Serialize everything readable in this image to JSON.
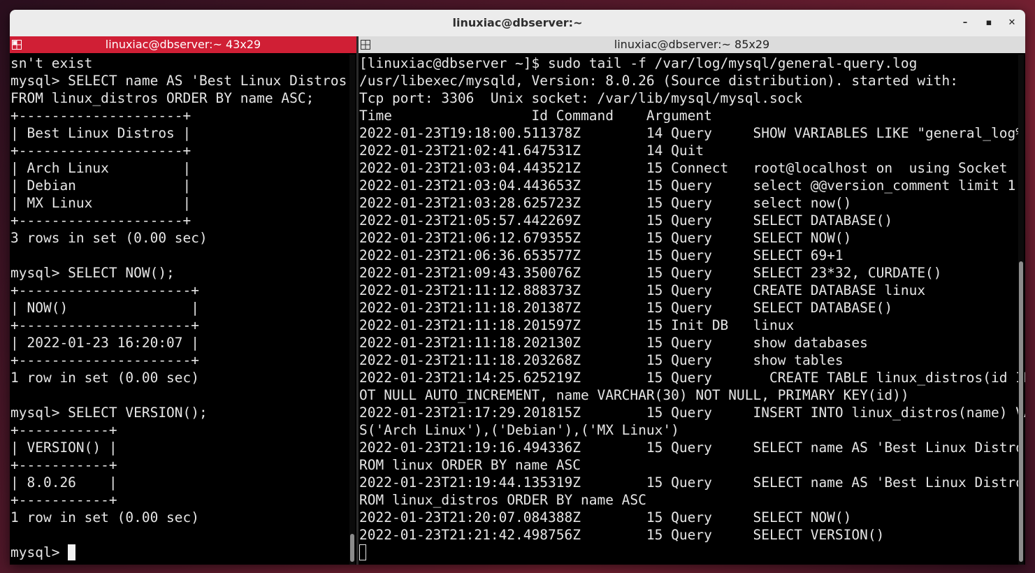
{
  "window": {
    "title": "linuxiac@dbserver:~",
    "minimize_glyph": "–",
    "maximize_glyph": "▪",
    "close_glyph": "✕"
  },
  "left_pane": {
    "title": "linuxiac@dbserver:~ 43x29",
    "icon": "split-terminal-icon",
    "lines": [
      "sn't exist",
      "mysql> SELECT name AS 'Best Linux Distros'",
      "FROM linux_distros ORDER BY name ASC;",
      "+--------------------+",
      "| Best Linux Distros |",
      "+--------------------+",
      "| Arch Linux         |",
      "| Debian             |",
      "| MX Linux           |",
      "+--------------------+",
      "3 rows in set (0.00 sec)",
      "",
      "mysql> SELECT NOW();",
      "+---------------------+",
      "| NOW()               |",
      "+---------------------+",
      "| 2022-01-23 16:20:07 |",
      "+---------------------+",
      "1 row in set (0.00 sec)",
      "",
      "mysql> SELECT VERSION();",
      "+-----------+",
      "| VERSION() |",
      "+-----------+",
      "| 8.0.26    |",
      "+-----------+",
      "1 row in set (0.00 sec)",
      ""
    ],
    "prompt": "mysql> "
  },
  "right_pane": {
    "title": "linuxiac@dbserver:~ 85x29",
    "icon": "split-terminal-icon",
    "lines": [
      "[linuxiac@dbserver ~]$ sudo tail -f /var/log/mysql/general-query.log",
      "/usr/libexec/mysqld, Version: 8.0.26 (Source distribution). started with:",
      "Tcp port: 3306  Unix socket: /var/lib/mysql/mysql.sock",
      "Time                 Id Command    Argument",
      "2022-01-23T19:18:00.511378Z        14 Query     SHOW VARIABLES LIKE \"general_log%\"",
      "2022-01-23T21:02:41.647531Z        14 Quit",
      "2022-01-23T21:03:04.443521Z        15 Connect   root@localhost on  using Socket",
      "2022-01-23T21:03:04.443653Z        15 Query     select @@version_comment limit 1",
      "2022-01-23T21:03:28.625723Z        15 Query     select now()",
      "2022-01-23T21:05:57.442269Z        15 Query     SELECT DATABASE()",
      "2022-01-23T21:06:12.679355Z        15 Query     SELECT NOW()",
      "2022-01-23T21:06:36.653577Z        15 Query     SELECT 69+1",
      "2022-01-23T21:09:43.350076Z        15 Query     SELECT 23*32, CURDATE()",
      "2022-01-23T21:11:12.888373Z        15 Query     CREATE DATABASE linux",
      "2022-01-23T21:11:18.201387Z        15 Query     SELECT DATABASE()",
      "2022-01-23T21:11:18.201597Z        15 Init DB   linux",
      "2022-01-23T21:11:18.202130Z        15 Query     show databases",
      "2022-01-23T21:11:18.203268Z        15 Query     show tables",
      "2022-01-23T21:14:25.625219Z        15 Query       CREATE TABLE linux_distros(id INT N",
      "OT NULL AUTO_INCREMENT, name VARCHAR(30) NOT NULL, PRIMARY KEY(id))",
      "2022-01-23T21:17:29.201815Z        15 Query     INSERT INTO linux_distros(name) VALUE",
      "S('Arch Linux'),('Debian'),('MX Linux')",
      "2022-01-23T21:19:16.494336Z        15 Query     SELECT name AS 'Best Linux Distros' F",
      "ROM linux ORDER BY name ASC",
      "2022-01-23T21:19:44.135319Z        15 Query     SELECT name AS 'Best Linux Distros' F",
      "ROM linux_distros ORDER BY name ASC",
      "2022-01-23T21:20:07.084388Z        15 Query     SELECT NOW()",
      "2022-01-23T21:21:42.498756Z        15 Query     SELECT VERSION()"
    ]
  }
}
